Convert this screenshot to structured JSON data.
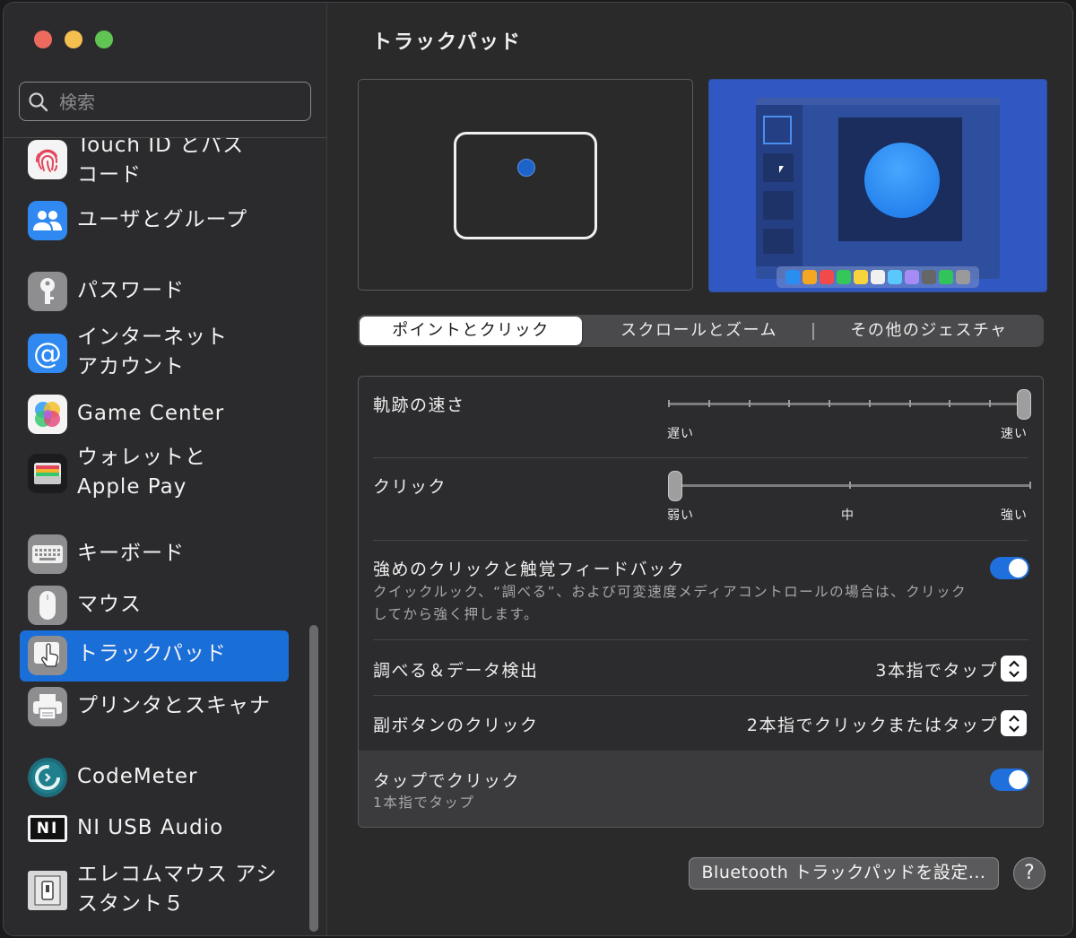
{
  "window": {
    "title": "トラックパッド",
    "traffic_colors": {
      "close": "#ed6a5e",
      "minimize": "#f5bf4f",
      "zoom": "#61c554"
    }
  },
  "search": {
    "placeholder": "検索"
  },
  "sidebar": {
    "items": [
      {
        "label": "Touch ID とパス\nコード",
        "icon": "fingerprint-icon"
      },
      {
        "label": "ユーザとグループ",
        "icon": "users-icon"
      },
      {
        "label": "パスワード",
        "icon": "key-icon"
      },
      {
        "label": "インターネット\nアカウント",
        "icon": "at-icon"
      },
      {
        "label": "Game Center",
        "icon": "game-center-icon"
      },
      {
        "label": "ウォレットと\nApple Pay",
        "icon": "wallet-icon"
      },
      {
        "label": "キーボード",
        "icon": "keyboard-icon"
      },
      {
        "label": "マウス",
        "icon": "mouse-icon"
      },
      {
        "label": "トラックパッド",
        "icon": "trackpad-icon",
        "selected": true
      },
      {
        "label": "プリンタとスキャナ",
        "icon": "printer-icon"
      },
      {
        "label": "CodeMeter",
        "icon": "codemeter-icon"
      },
      {
        "label": "NI USB Audio",
        "icon": "ni-icon"
      },
      {
        "label": "エレコムマウス アシ\nスタント５",
        "icon": "elecom-icon"
      }
    ]
  },
  "tabs": [
    {
      "label": "ポイントとクリック",
      "selected": true
    },
    {
      "label": "スクロールとズーム"
    },
    {
      "label": "その他のジェスチャ"
    }
  ],
  "settings": {
    "tracking_speed": {
      "label": "軌跡の速さ",
      "min_label": "遅い",
      "max_label": "速い",
      "value": 1.0
    },
    "click": {
      "label": "クリック",
      "min_label": "弱い",
      "mid_label": "中",
      "max_label": "強い",
      "value": 0.0
    },
    "force_click": {
      "label": "強めのクリックと触覚フィードバック",
      "description": "クイックルック、“調べる”、および可変速度メディアコントロールの場合は、クリック\nしてから強く押します。",
      "enabled": true
    },
    "lookup": {
      "label": "調べる＆データ検出",
      "value": "3本指でタップ"
    },
    "secondary_click": {
      "label": "副ボタンのクリック",
      "value": "2本指でクリックまたはタップ"
    },
    "tap_to_click": {
      "label": "タップでクリック",
      "description": "1本指でタップ",
      "enabled": true
    }
  },
  "buttons": {
    "bluetooth": "Bluetooth トラックパッドを設定...",
    "help": "?"
  },
  "dock_colors": [
    "#2a8ef0",
    "#f5a623",
    "#f2494b",
    "#34c759",
    "#f7d43b",
    "#f0f0f0",
    "#5ac8fa",
    "#a58cf5",
    "#666666",
    "#30c45a",
    "#9a9a9a"
  ]
}
